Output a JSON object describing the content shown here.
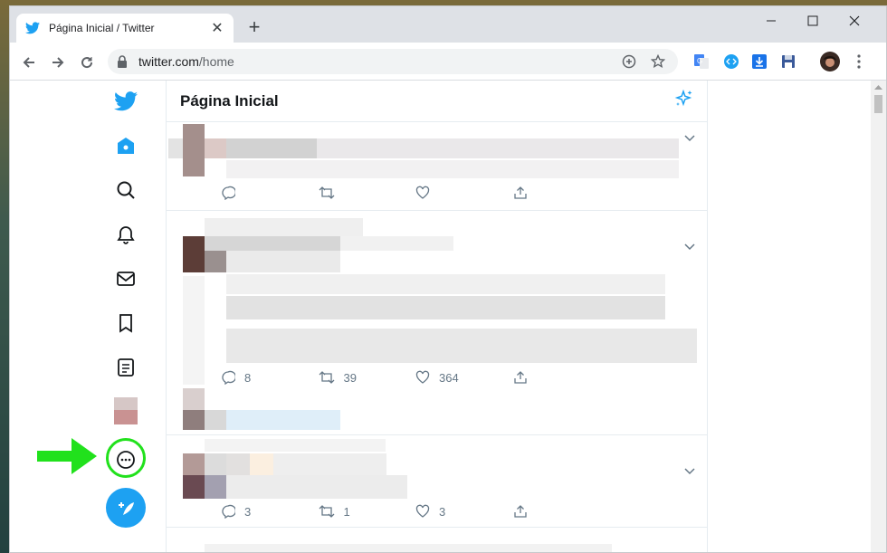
{
  "browser": {
    "tab_title": "Página Inicial / Twitter",
    "tab_close": "✕",
    "new_tab": "+",
    "url_host": "twitter.com",
    "url_path": "/home"
  },
  "window_controls": {
    "minimize": "—",
    "maximize": "☐",
    "close": "✕"
  },
  "feed": {
    "title": "Página Inicial",
    "tweets": [
      {
        "replies": "",
        "retweets": "",
        "likes": ""
      },
      {
        "replies": "8",
        "retweets": "39",
        "likes": "364"
      },
      {
        "replies": "3",
        "retweets": "1",
        "likes": "3"
      }
    ]
  },
  "colors": {
    "accent": "#1da1f2",
    "highlight": "#21e11c"
  },
  "icons": {
    "sidebar": [
      "twitter-logo-icon",
      "home-icon",
      "search-icon",
      "bell-icon",
      "mail-icon",
      "bookmark-icon",
      "list-icon",
      "profile-avatar",
      "more-icon",
      "compose-icon"
    ]
  }
}
